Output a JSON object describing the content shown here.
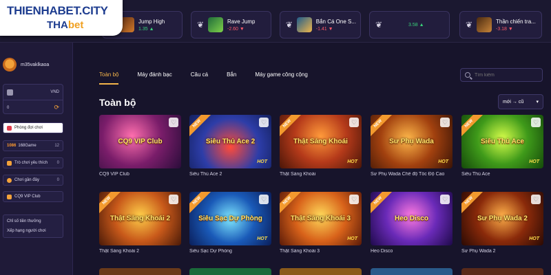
{
  "logo": {
    "line1": "THIENHABET.CITY",
    "line2a": "THA",
    "line2b": "bet"
  },
  "tickers": [
    {
      "name": "Jump High",
      "value": "1.35",
      "trend": "up"
    },
    {
      "name": "Rave Jump",
      "value": "-2.60",
      "trend": "down"
    },
    {
      "name": "Bắn Cá One S...",
      "value": "-1.41",
      "trend": "down"
    },
    {
      "name": "",
      "value": "3.58",
      "trend": "up"
    },
    {
      "name": "Thần chiến tra...",
      "value": "-3.18",
      "trend": "down"
    }
  ],
  "sidebar": {
    "username": "m35vaklkaoa",
    "currency": "VND",
    "balance": "0",
    "menu": [
      {
        "label": "Phòng đợi chơi",
        "count": ""
      },
      {
        "label": "168Game",
        "badge": "1086",
        "count": "12"
      },
      {
        "label": "Trò chơi yêu thích",
        "count": "0"
      },
      {
        "label": "Chơi gần đây",
        "count": "0"
      },
      {
        "label": "CQ9 VIP Club",
        "count": ""
      }
    ],
    "links": [
      "Chỉ số tiền thưởng",
      "Xếp hạng người chơi"
    ]
  },
  "tabs": [
    "Toàn bộ",
    "Máy đánh bạc",
    "Câu cá",
    "Bắn",
    "Máy game công cộng"
  ],
  "search": {
    "placeholder": "Tìm kiếm"
  },
  "section_title": "Toàn bộ",
  "sort": {
    "value": "mới → cũ"
  },
  "games": [
    {
      "title": "CQ9 VIP Club",
      "art": "CQ9 VIP Club",
      "new": false,
      "hot": false
    },
    {
      "title": "Siêu Thủ Ace 2",
      "art": "Siêu Thủ Ace 2",
      "new": true,
      "hot": true
    },
    {
      "title": "Thật Sảng Khoái",
      "art": "Thật Sảng Khoái",
      "new": true,
      "hot": true
    },
    {
      "title": "Sư Phụ Wada Chế độ Tốc Độ Cao",
      "art": "Sư Phụ Wada",
      "new": true,
      "hot": true
    },
    {
      "title": "Siêu Thủ Ace",
      "art": "Siêu Thủ Ace",
      "new": true,
      "hot": true
    },
    {
      "title": "Thật Sảng Khoái 2",
      "art": "Thật Sảng Khoái 2",
      "new": true,
      "hot": false
    },
    {
      "title": "Siêu Sạc Dự Phòng",
      "art": "Siêu Sạc Dự Phòng",
      "new": true,
      "hot": true
    },
    {
      "title": "Thật Sảng Khoái 3",
      "art": "Thật Sảng Khoái 3",
      "new": true,
      "hot": true
    },
    {
      "title": "Heo Disco",
      "art": "Heo Disco",
      "new": true,
      "hot": false
    },
    {
      "title": "Sư Phụ Wada 2",
      "art": "Sư Phụ Wada 2",
      "new": true,
      "hot": true
    }
  ],
  "labels": {
    "new": "NEW",
    "hot": "HOT"
  },
  "colors": {
    "accent": "#f5b54a",
    "background": "#17142b",
    "up": "#39d17a",
    "down": "#ff5a6a"
  }
}
